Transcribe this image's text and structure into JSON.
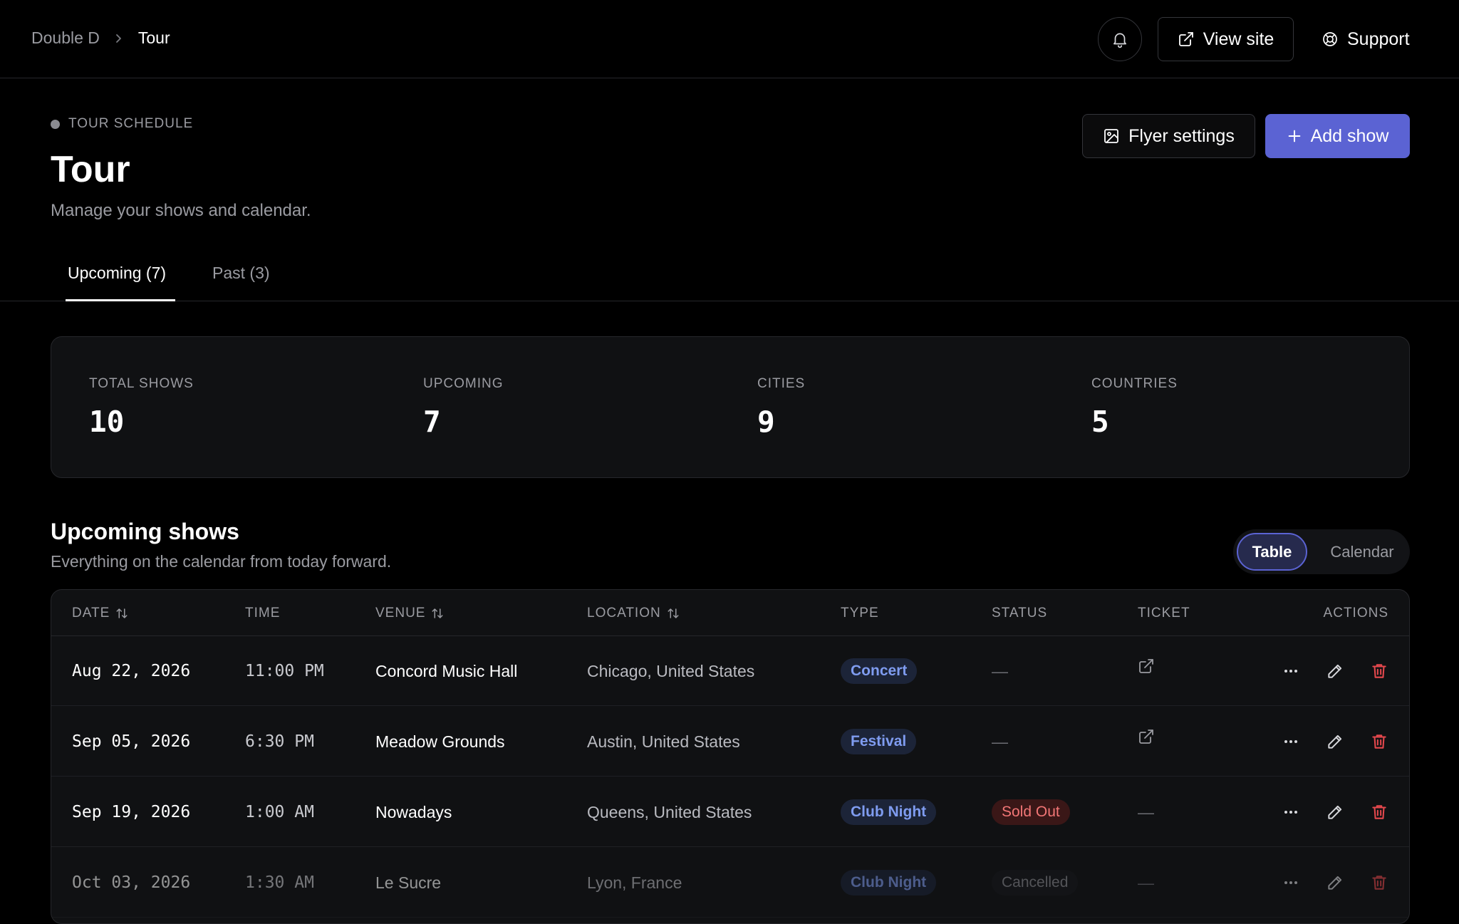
{
  "breadcrumb": {
    "root": "Double D",
    "current": "Tour"
  },
  "topbar": {
    "view_site": "View site",
    "support": "Support"
  },
  "header": {
    "eyebrow": "TOUR SCHEDULE",
    "title": "Tour",
    "subtitle": "Manage your shows and calendar.",
    "flyer_settings": "Flyer settings",
    "add_show": "Add show"
  },
  "tabs": {
    "upcoming": "Upcoming (7)",
    "past": "Past (3)"
  },
  "stats": [
    {
      "label": "TOTAL SHOWS",
      "value": "10"
    },
    {
      "label": "UPCOMING",
      "value": "7"
    },
    {
      "label": "CITIES",
      "value": "9"
    },
    {
      "label": "COUNTRIES",
      "value": "5"
    }
  ],
  "section": {
    "title": "Upcoming shows",
    "subtitle": "Everything on the calendar from today forward.",
    "view_table": "Table",
    "view_calendar": "Calendar"
  },
  "table": {
    "columns": [
      "DATE",
      "TIME",
      "VENUE",
      "LOCATION",
      "TYPE",
      "STATUS",
      "TICKET",
      "ACTIONS"
    ],
    "rows": [
      {
        "date": "Aug 22, 2026",
        "time": "11:00 PM",
        "venue": "Concord Music Hall",
        "location": "Chicago, United States",
        "type": "Concert",
        "status": "—",
        "ticket": "link"
      },
      {
        "date": "Sep 05, 2026",
        "time": "6:30 PM",
        "venue": "Meadow Grounds",
        "location": "Austin, United States",
        "type": "Festival",
        "status": "—",
        "ticket": "link"
      },
      {
        "date": "Sep 19, 2026",
        "time": "1:00 AM",
        "venue": "Nowadays",
        "location": "Queens, United States",
        "type": "Club Night",
        "status": "Sold Out",
        "ticket": "—"
      },
      {
        "date": "Oct 03, 2026",
        "time": "1:30 AM",
        "venue": "Le Sucre",
        "location": "Lyon, France",
        "type": "Club Night",
        "status": "Cancelled",
        "ticket": "—"
      }
    ]
  },
  "colors": {
    "accent": "#5b63d3",
    "danger": "#e5484d",
    "type_badge": "#7f9cf0"
  }
}
